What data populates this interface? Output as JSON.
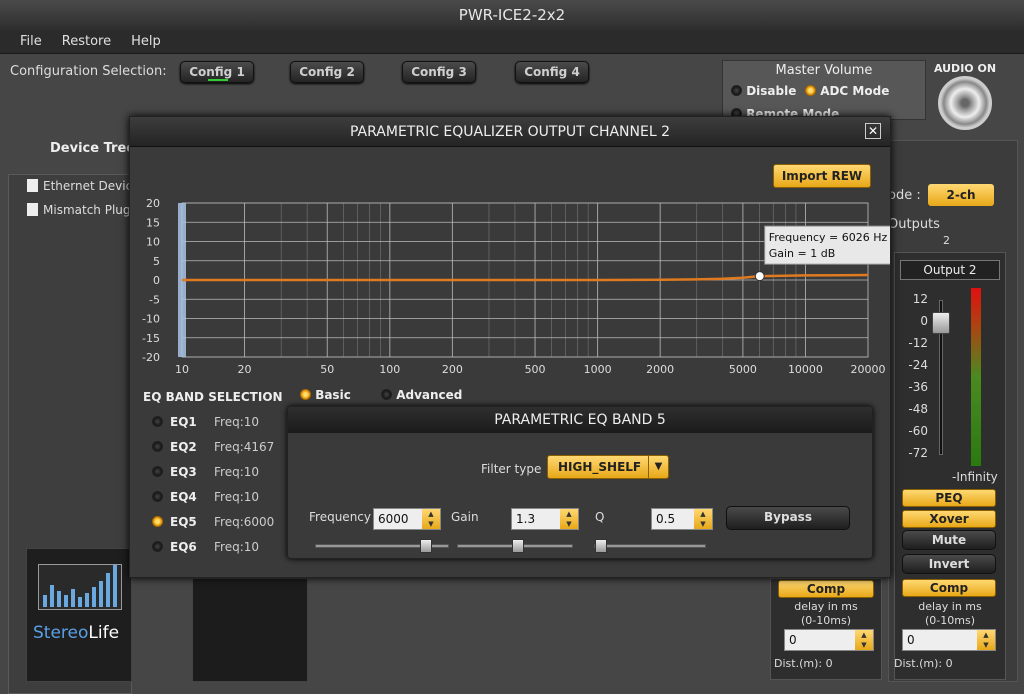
{
  "app": {
    "title": "PWR-ICE2-2x2"
  },
  "menu": [
    "File",
    "Restore",
    "Help"
  ],
  "config": {
    "label": "Configuration Selection:",
    "buttons": [
      "Config 1",
      "Config 2",
      "Config 3",
      "Config 4"
    ],
    "active_index": 0
  },
  "master_volume": {
    "title": "Master Volume",
    "options": [
      "Disable",
      "ADC Mode",
      "Remote Mode"
    ],
    "selected": "ADC Mode"
  },
  "audio": {
    "label": "AUDIO ON"
  },
  "device_tree": {
    "title": "Device Tree",
    "items": [
      "Ethernet Devic",
      "Mismatch Plugi"
    ]
  },
  "logo": {
    "text_a": "Stereo",
    "text_b": "Life"
  },
  "right": {
    "mode_label": "ode :",
    "mode_value": "2-ch",
    "outputs_label": "Outputs",
    "outputs_num": "2",
    "output_title": "Output 2",
    "scale": [
      "12",
      "0",
      "-12",
      "-24",
      "-36",
      "-48",
      "-60",
      "-72"
    ],
    "infinity": "-Infinity",
    "buttons": {
      "peq": "PEQ",
      "xover": "Xover",
      "mute": "Mute",
      "invert": "Invert",
      "comp": "Comp"
    },
    "delay_label": "delay in ms",
    "delay_range": "(0-10ms)",
    "delay_value": "0",
    "dist": "Dist.(m): 0"
  },
  "ch1": {
    "comp": "Comp",
    "delay_label": "delay in ms",
    "delay_range": "(0-10ms)",
    "delay_value": "0",
    "dist": "Dist.(m): 0"
  },
  "peq": {
    "title": "PARAMETRIC EQUALIZER OUTPUT CHANNEL 2",
    "close": "✕",
    "import_label": "Import REW",
    "band_selection_label": "EQ BAND SELECTION",
    "mode_options": [
      "Basic",
      "Advanced"
    ],
    "mode_selected": "Basic",
    "bands": [
      {
        "name": "EQ1",
        "freq": "Freq:10"
      },
      {
        "name": "EQ2",
        "freq": "Freq:4167"
      },
      {
        "name": "EQ3",
        "freq": "Freq:10"
      },
      {
        "name": "EQ4",
        "freq": "Freq:10"
      },
      {
        "name": "EQ5",
        "freq": "Freq:6000"
      },
      {
        "name": "EQ6",
        "freq": "Freq:10"
      }
    ],
    "selected_band": 4
  },
  "band": {
    "title": "PARAMETRIC EQ BAND 5",
    "filter_label": "Filter type",
    "filter_value": "HIGH_SHELF",
    "freq_label": "Frequency",
    "freq_value": "6000",
    "gain_label": "Gain",
    "gain_value": "1.3",
    "q_label": "Q",
    "q_value": "0.5",
    "bypass_label": "Bypass"
  },
  "chart_data": {
    "type": "line",
    "x_ticks": [
      10,
      20,
      50,
      100,
      200,
      500,
      1000,
      2000,
      5000,
      10000,
      20000
    ],
    "y_ticks": [
      20,
      15,
      10,
      5,
      0,
      -5,
      -10,
      -15,
      -20
    ],
    "xlim": [
      10,
      20000
    ],
    "ylim": [
      -20,
      20
    ],
    "x_scale": "log",
    "grid": true,
    "series": [
      {
        "x": [
          10,
          100,
          1000,
          2000,
          3000,
          4000,
          5000,
          6026,
          8000,
          10000,
          15000,
          20000
        ],
        "y": [
          0,
          0,
          0,
          0.05,
          0.15,
          0.35,
          0.6,
          1,
          1.1,
          1.2,
          1.25,
          1.3
        ],
        "color": "#e07a20"
      }
    ],
    "marker": {
      "x": 6026,
      "y": 1
    },
    "tooltip": {
      "line1": "Frequency = 6026 Hz",
      "line2": "Gain = 1 dB"
    }
  }
}
